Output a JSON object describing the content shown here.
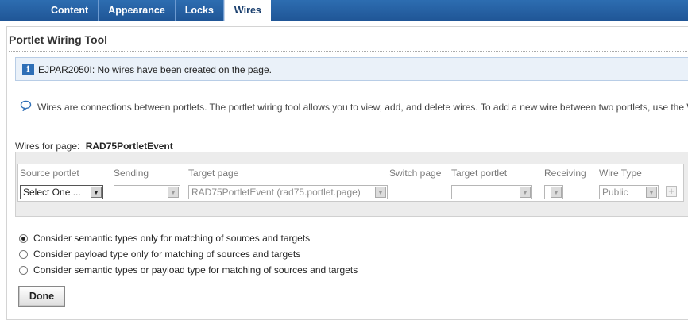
{
  "tabs": [
    {
      "label": "Content"
    },
    {
      "label": "Appearance"
    },
    {
      "label": "Locks"
    },
    {
      "label": "Wires"
    }
  ],
  "panel": {
    "title": "Portlet Wiring Tool"
  },
  "info_message": "EJPAR2050I: No wires have been created on the page.",
  "help_text": "Wires are connections between portlets. The portlet wiring tool allows you to view, add, and delete wires. To add a new wire between two portlets, use the Wire.",
  "wires_for_page": {
    "label": "Wires for page:",
    "page_name": "RAD75PortletEvent"
  },
  "table": {
    "headers": [
      "Source portlet",
      "Sending",
      "Target page",
      "Switch page",
      "Target portlet",
      "Receiving",
      "Wire Type"
    ],
    "row": {
      "source_portlet": "Select One ...",
      "sending": "",
      "target_page": "RAD75PortletEvent (rad75.portlet.page)",
      "target_portlet": "",
      "receiving": "",
      "wire_type": "Public"
    }
  },
  "matching_options": [
    {
      "label": "Consider semantic types only for matching of sources and targets",
      "selected": true
    },
    {
      "label": "Consider payload type only for matching of sources and targets",
      "selected": false
    },
    {
      "label": "Consider semantic types or payload type for matching of sources and targets",
      "selected": false
    }
  ],
  "done_label": "Done",
  "icons": {
    "info": "info-icon",
    "help": "speech-bubble-icon",
    "add": "plus-icon",
    "dropdown": "chevron-down-icon"
  }
}
